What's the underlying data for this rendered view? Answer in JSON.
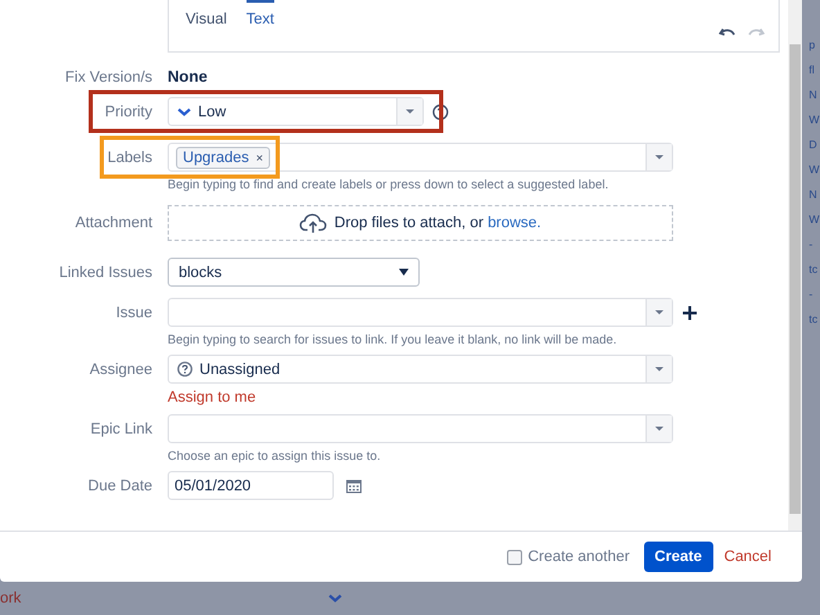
{
  "editor": {
    "tabs": [
      {
        "label": "Visual",
        "selected": false
      },
      {
        "label": "Text",
        "selected": true
      }
    ]
  },
  "fields": [
    {
      "kind": "readonly",
      "label": "Fix Version/s",
      "value": "None"
    },
    {
      "kind": "priority",
      "label": "Priority",
      "value": "Low",
      "highlight": {
        "color": "#b3301c"
      }
    },
    {
      "kind": "labels",
      "label": "Labels",
      "tags": [
        "Upgrades"
      ],
      "tag_remove": "×",
      "help": "Begin typing to find and create labels or press down to select a suggested label.",
      "highlight": {
        "color": "#f39a1e"
      }
    },
    {
      "kind": "dropzone",
      "label": "Attachment",
      "text": "Drop files to attach, or ",
      "link": "browse."
    },
    {
      "kind": "linktype",
      "label": "Linked Issues",
      "value": "blocks"
    },
    {
      "kind": "issue",
      "label": "Issue",
      "help": "Begin typing to search for issues to link. If you leave it blank, no link will be made."
    },
    {
      "kind": "assignee",
      "label": "Assignee",
      "value": "Unassigned",
      "link": "Assign to me"
    },
    {
      "kind": "picker",
      "label": "Epic Link",
      "help": "Choose an epic to assign this issue to."
    },
    {
      "kind": "date",
      "label": "Due Date",
      "value": "05/01/2020"
    }
  ],
  "footer": {
    "create_another": {
      "label": "Create another",
      "checked": false
    },
    "buttons": [
      {
        "label": "Create",
        "kind": "primary"
      },
      {
        "label": "Cancel",
        "kind": "link"
      }
    ]
  },
  "backdrop": {
    "bottom_text": "ork",
    "side_texts": [
      "p",
      "fl",
      "N",
      "W",
      "D",
      "W",
      "N",
      "W",
      "-",
      "tc",
      "-",
      "tc"
    ]
  }
}
